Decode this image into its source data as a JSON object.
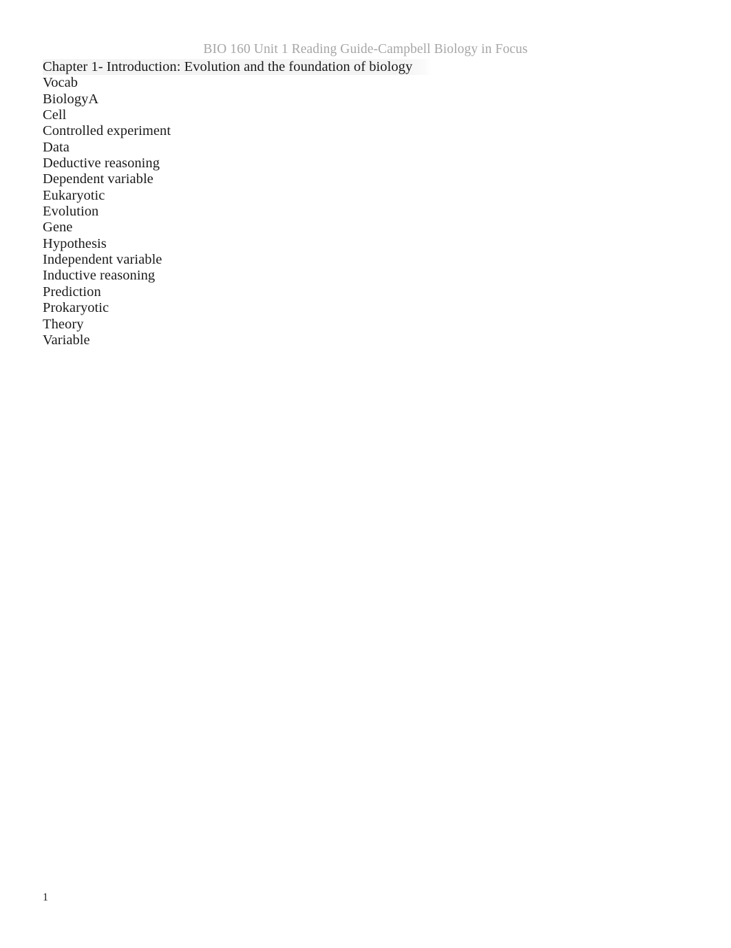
{
  "document": {
    "header_text": "BIO 160 Unit 1 Reading Guide-Campbell Biology in Focus",
    "chapter_title": "Chapter 1- Introduction: Evolution and the foundation of biology",
    "section_label": "Vocab",
    "page_number": "1",
    "colors": {
      "page_background": "#ffffff",
      "header_text": "#a6a6a6",
      "body_text": "#1a1a1a",
      "highlight_band": "rgba(0,0,0,0.045)"
    },
    "vocab_terms": [
      "BiologyA",
      "Cell",
      "Controlled experiment",
      "Data",
      "Deductive reasoning",
      "Dependent variable",
      "Eukaryotic",
      "Evolution",
      "Gene",
      "Hypothesis",
      "Independent variable",
      "Inductive reasoning",
      "Prediction",
      "Prokaryotic",
      "Theory",
      "Variable"
    ]
  }
}
